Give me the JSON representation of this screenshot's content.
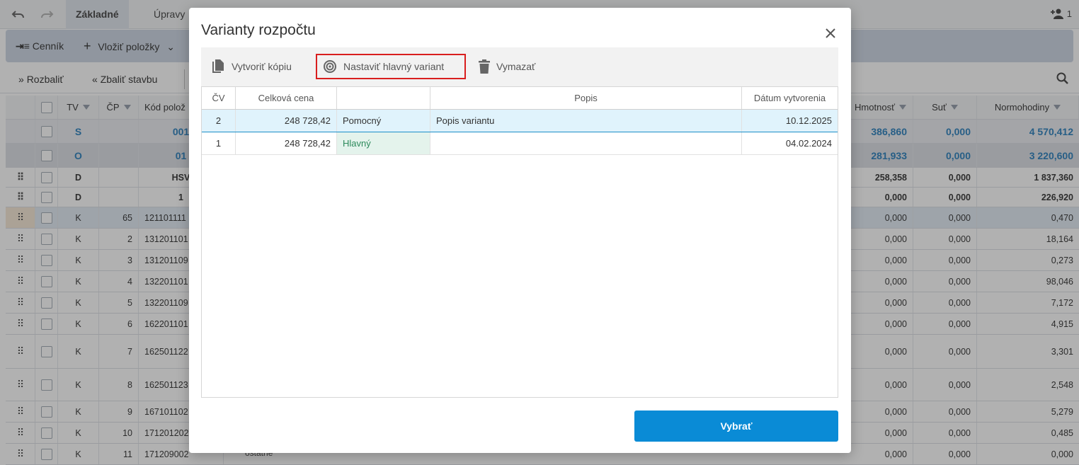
{
  "topbar": {
    "tabs": [
      {
        "label": "Základné"
      },
      {
        "label": "Úpravy"
      }
    ],
    "user_count": "1"
  },
  "toolbar": {
    "pricelist_label": "Cenník",
    "insert_items_label": "Vložiť položky"
  },
  "toolbar2": {
    "expand_label": "Rozbaliť",
    "collapse_label": "Zbaliť stavbu"
  },
  "grid": {
    "headers": {
      "tv": "TV",
      "cp": "ČP",
      "code": "Kód polož",
      "weight": "Hmotnosť",
      "debris": "Suť",
      "hours": "Normohodiny"
    },
    "rows": [
      {
        "tv": "S",
        "cp": "",
        "code": "001",
        "weight": "386,860",
        "debris": "0,000",
        "hours": "4 570,412"
      },
      {
        "tv": "O",
        "cp": "",
        "code": "01",
        "weight": "281,933",
        "debris": "0,000",
        "hours": "3 220,600"
      },
      {
        "tv": "D",
        "cp": "",
        "code": "HSV",
        "weight": "258,358",
        "debris": "0,000",
        "hours": "1 837,360"
      },
      {
        "tv": "D",
        "cp": "",
        "code": "1",
        "weight": "0,000",
        "debris": "0,000",
        "hours": "226,920"
      },
      {
        "tv": "K",
        "cp": "65",
        "code": "121101111",
        "weight": "0,000",
        "debris": "0,000",
        "hours": "0,470"
      },
      {
        "tv": "K",
        "cp": "2",
        "code": "131201101",
        "weight": "0,000",
        "debris": "0,000",
        "hours": "18,164"
      },
      {
        "tv": "K",
        "cp": "3",
        "code": "131201109",
        "weight": "0,000",
        "debris": "0,000",
        "hours": "0,273"
      },
      {
        "tv": "K",
        "cp": "4",
        "code": "132201101",
        "weight": "0,000",
        "debris": "0,000",
        "hours": "98,046"
      },
      {
        "tv": "K",
        "cp": "5",
        "code": "132201109",
        "weight": "0,000",
        "debris": "0,000",
        "hours": "7,172"
      },
      {
        "tv": "K",
        "cp": "6",
        "code": "162201101",
        "weight": "0,000",
        "debris": "0,000",
        "hours": "4,915"
      },
      {
        "tv": "K",
        "cp": "7",
        "code": "162501122",
        "weight": "0,000",
        "debris": "0,000",
        "hours": "3,301"
      },
      {
        "tv": "K",
        "cp": "8",
        "code": "162501123",
        "weight": "0,000",
        "debris": "0,000",
        "hours": "2,548"
      },
      {
        "tv": "K",
        "cp": "9",
        "code": "167101102",
        "weight": "0,000",
        "debris": "0,000",
        "hours": "5,279"
      },
      {
        "tv": "K",
        "cp": "10",
        "code": "171201202",
        "weight": "0,000",
        "debris": "0,000",
        "hours": "0,485"
      },
      {
        "tv": "K",
        "cp": "11",
        "code": "171209002",
        "weight": "0,000",
        "debris": "0,000",
        "hours": "0,000"
      }
    ],
    "trailing_text": "ostatné"
  },
  "modal": {
    "title": "Varianty rozpočtu",
    "toolbar": {
      "copy_label": "Vytvoriť kópiu",
      "set_main_label": "Nastaviť hlavný variant",
      "delete_label": "Vymazať"
    },
    "table": {
      "headers": {
        "cv": "ČV",
        "price": "Celková cena",
        "type": "",
        "desc": "Popis",
        "date": "Dátum vytvorenia"
      },
      "rows": [
        {
          "cv": "2",
          "price": "248 728,42",
          "type": "Pomocný",
          "desc": "Popis variantu",
          "date": "10.12.2025"
        },
        {
          "cv": "1",
          "price": "248 728,42",
          "type": "Hlavný",
          "desc": "",
          "date": "04.02.2024"
        }
      ]
    },
    "select_label": "Vybrať"
  },
  "colors": {
    "accent": "#0a8bd6",
    "highlight": "#d91e1e",
    "main_variant": "#2e8a5c"
  }
}
